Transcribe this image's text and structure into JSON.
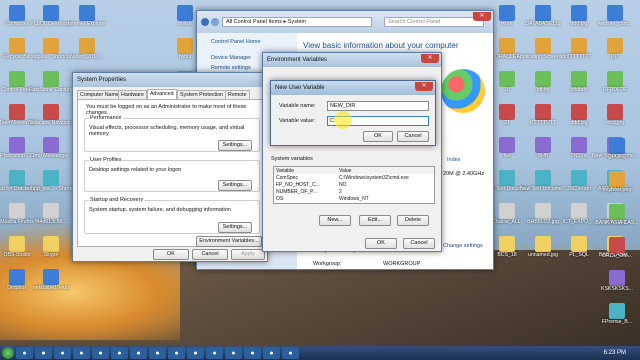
{
  "desktop": {
    "left_col1": [
      "Computer",
      "Recycle Bin",
      "Control Panel",
      "TeamViewer 12",
      "Photoshop CC",
      "Toad for Oracle 12.1",
      "Mozilla Firefox",
      "OBS Studio",
      "Dropbox"
    ],
    "left_col2": [
      "PLSQL Developer",
      "sqlplus - Shortcut",
      "FastStone Capture",
      "Netscape Navigator",
      "Imo Messenger",
      "xampp_sta... - Shortcut",
      "f44d613c88...",
      "Skype",
      "netscape10-run"
    ],
    "left_col3": [
      "Internet Explorer",
      "Video_2017..."
    ],
    "col_mid": [
      "nwise",
      "rwbui",
      "Th",
      "RIP",
      "Rec",
      "EX",
      "BIR"
    ],
    "right_col1": [
      "work",
      "ORACLE1",
      "18",
      "21",
      "fsd",
      "New Text Docume...",
      "Oracle_ALL",
      "BCS_18"
    ],
    "right_col2": [
      "DATABASE11g",
      "Application Screenshot",
      "bfkbfj",
      "KTTTTUTT",
      "BHB",
      "New Text Docume...",
      "BHB8LO2.jpg",
      "unnamed.jpg"
    ],
    "right_col3": [
      "ddd.jpg",
      "TTTTTTTT",
      "fdfdfdfd",
      "ddd.jpg",
      "TNS.txt",
      "JSC exam",
      "ICT_EXPO_...",
      "PL_SQL"
    ],
    "right_col4": [
      "website_com...",
      "DIT",
      "DFDDFDF",
      "msg.jpg",
      "New Text Docume...",
      "APP_SER_1...",
      "myBC.jpg",
      "BKB_CASH..."
    ],
    "right_col5": [
      "QPOPQ",
      "keyboar.png",
      "BANK ASIA CAS...",
      "ORCL_OM...",
      "KSKSKSKS...",
      "FPremie_B..."
    ]
  },
  "control_panel": {
    "breadcrumb": [
      "All Control Panel Items",
      "System"
    ],
    "search_placeholder": "Search Control Panel",
    "home": "Control Panel Home",
    "links": [
      "Device Manager",
      "Remote settings"
    ],
    "heading": "View basic information about your computer",
    "lines": [
      "Index",
      "20M @ 2.40GHz"
    ],
    "change_settings": "Change settings",
    "desc_label": "Computer description:",
    "workgroup_label": "Workgroup:",
    "workgroup_value": "WORKGROUP"
  },
  "system_properties": {
    "title": "System Properties",
    "tabs": [
      "Computer Name",
      "Hardware",
      "Advanced",
      "System Protection",
      "Remote"
    ],
    "admin_note": "You must be logged on as an Administrator to make most of these changes.",
    "perf_title": "Performance",
    "perf_text": "Visual effects, processor scheduling, memory usage, and virtual memory",
    "profiles_title": "User Profiles",
    "profiles_text": "Desktop settings related to your logon",
    "startup_title": "Startup and Recovery",
    "startup_text": "System startup, system failure, and debugging information",
    "settings": "Settings...",
    "env_button": "Environment Variables...",
    "ok": "OK",
    "cancel": "Cancel",
    "apply": "Apply"
  },
  "env_vars": {
    "title": "Environment Variables",
    "sys_label": "System variables",
    "col_variable": "Variable",
    "col_value": "Value",
    "rows": [
      {
        "name": "ComSpec",
        "value": "C:\\Windows\\system32\\cmd.exe"
      },
      {
        "name": "FP_NO_HOST_C...",
        "value": "NO"
      },
      {
        "name": "NUMBER_OF_P...",
        "value": "2"
      },
      {
        "name": "OS",
        "value": "Windows_NT"
      }
    ],
    "new": "New...",
    "edit": "Edit...",
    "delete": "Delete",
    "ok": "OK",
    "cancel": "Cancel"
  },
  "new_var": {
    "title": "New User Variable",
    "name_label": "Variable name:",
    "name_value": "NEW_DIR",
    "value_label": "Variable value:",
    "value_value": "C:",
    "ok": "OK",
    "cancel": "Cancel"
  },
  "taskbar": {
    "time": "6:23 PM"
  }
}
